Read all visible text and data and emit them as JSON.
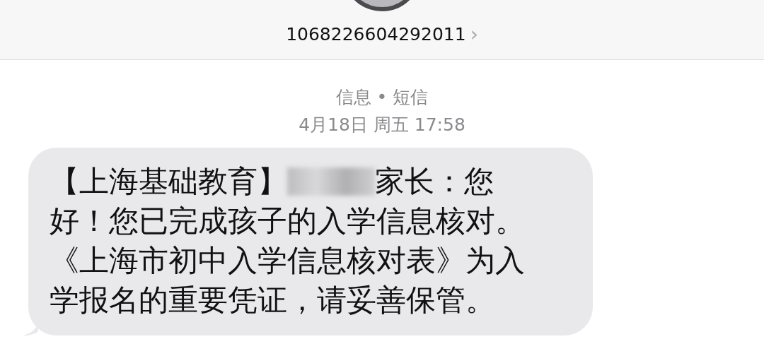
{
  "contact": {
    "number": "1068226604292011",
    "chevron": "›"
  },
  "message_meta": {
    "service": "信息 • 短信",
    "timestamp": "4月18日 周五 17:58"
  },
  "message": {
    "prefix": "【上海基础教育】",
    "redacted": true,
    "lines": [
      "家长：您",
      "好！您已完成孩子的入学信息核对。",
      "《上海市初中入学信息核对表》为入",
      "学报名的重要凭证，请妥善保管。"
    ]
  }
}
